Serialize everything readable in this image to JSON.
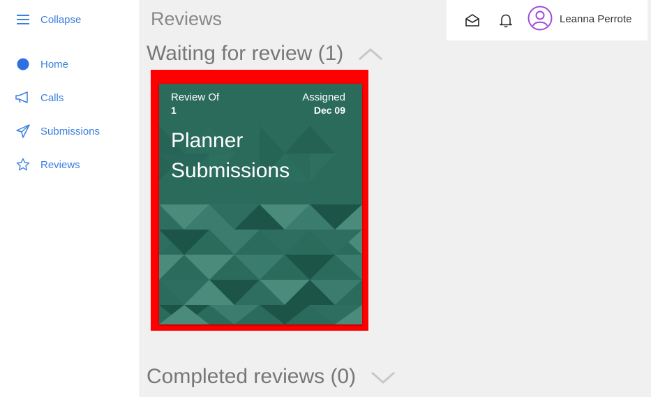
{
  "sidebar": {
    "collapse_label": "Collapse",
    "items": [
      {
        "label": "Home",
        "icon": "home-dot-icon"
      },
      {
        "label": "Calls",
        "icon": "megaphone-icon"
      },
      {
        "label": "Submissions",
        "icon": "paper-plane-icon"
      },
      {
        "label": "Reviews",
        "icon": "star-icon"
      }
    ]
  },
  "topbar": {
    "mail_icon": "envelope-open-icon",
    "bell_icon": "bell-icon",
    "user_name": "Leanna Perrote",
    "avatar_color": "#a24bd8"
  },
  "main": {
    "page_title": "Reviews",
    "waiting_section": "Waiting for review (1)",
    "completed_section": "Completed reviews (0)",
    "card": {
      "review_of_label": "Review Of",
      "review_of_value": "1",
      "assigned_label": "Assigned",
      "assigned_value": "Dec 09",
      "title_line1": "Planner",
      "title_line2": "Submissions",
      "color": "#2a6b5c",
      "highlight_color": "#ff0000"
    }
  },
  "colors": {
    "accent": "#3b7fe0",
    "background": "#f0f0f0"
  }
}
